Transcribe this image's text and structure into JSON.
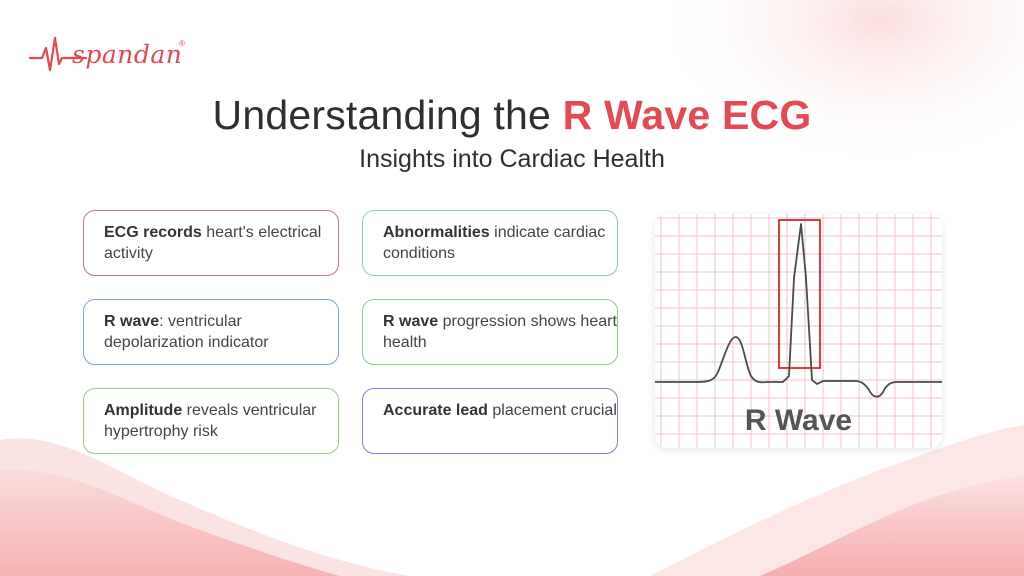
{
  "brand": {
    "name": "spandan",
    "registered": "®",
    "color": "#e34750"
  },
  "title": {
    "prefix": "Understanding the ",
    "highlight": "R Wave ECG",
    "subtitle": "Insights into Cardiac Health",
    "accent_color": "#e34a52"
  },
  "cards": [
    {
      "bold": "ECG records",
      "text": " heart's electrical activity",
      "line2": "",
      "border": "#c97a7e"
    },
    {
      "bold": "Abnormalities",
      "text": " indicate cardiac conditions",
      "line2": "",
      "border": "#8fc6cf"
    },
    {
      "bold": "R wave",
      "text": ": ventricular depolarization indicator",
      "line2": "",
      "border": "#7fa3dc"
    },
    {
      "bold": "R wave",
      "text": " progression shows heart health",
      "line2": "",
      "border": "#8dcf8f"
    },
    {
      "bold": "Amplitude",
      "text": " reveals ventricular hypertrophy risk",
      "line2": "",
      "border": "#9ccc8a"
    },
    {
      "bold": "Accurate lead",
      "text": " placement crucial",
      "line2": "",
      "border": "#7b86cf"
    }
  ],
  "ecg": {
    "label": "R Wave",
    "grid_color": "#f3c2c4",
    "highlight_color": "#d8262f",
    "trace_color": "#4a4a4a"
  }
}
